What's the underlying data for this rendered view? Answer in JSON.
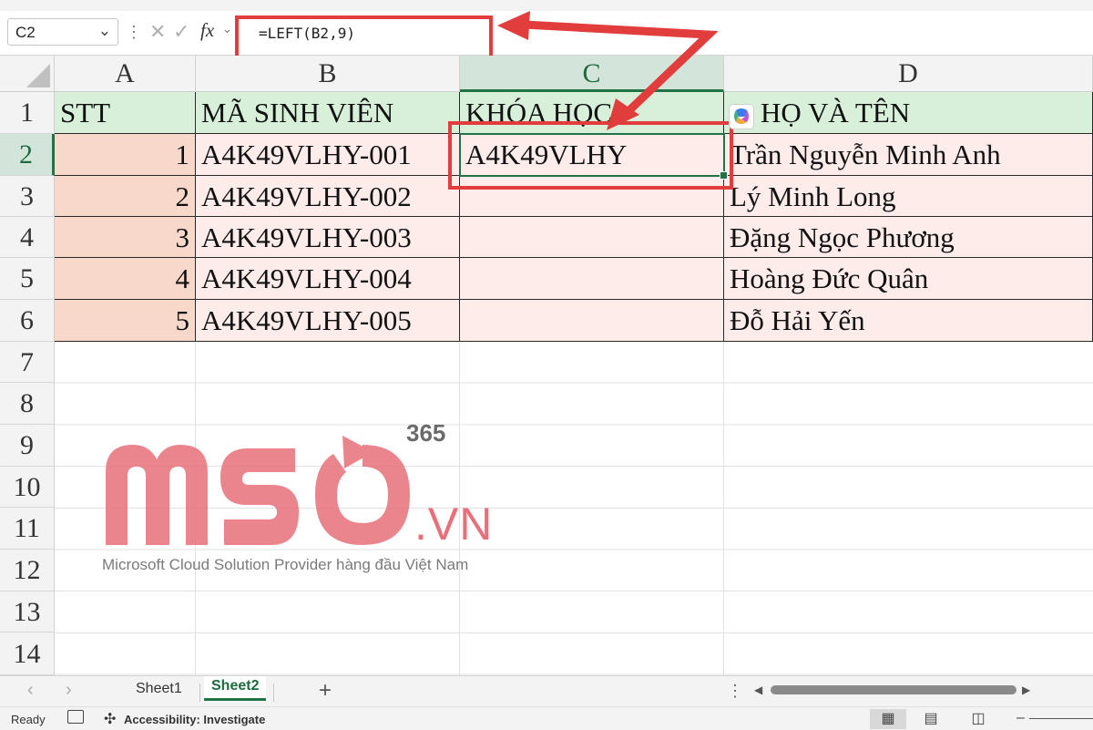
{
  "formula_bar": {
    "name_box": "C2",
    "formula": "=LEFT(B2,9)",
    "fx_label": "fx"
  },
  "columns": [
    "A",
    "B",
    "C",
    "D"
  ],
  "rows": [
    "1",
    "2",
    "3",
    "4",
    "5",
    "6",
    "7",
    "8",
    "9",
    "10",
    "11",
    "12",
    "13",
    "14"
  ],
  "table": {
    "headers": [
      "STT",
      "MÃ SINH VIÊN",
      "KHÓA HỌC",
      "HỌ VÀ TÊN"
    ],
    "rows": [
      [
        "1",
        "A4K49VLHY-001",
        "A4K49VLHY",
        "Trần Nguyễn Minh Anh"
      ],
      [
        "2",
        "A4K49VLHY-002",
        "",
        "Lý Minh Long"
      ],
      [
        "3",
        "A4K49VLHY-003",
        "",
        "Đặng Ngọc Phương"
      ],
      [
        "4",
        "A4K49VLHY-004",
        "",
        "Hoàng Đức Quân"
      ],
      [
        "5",
        "A4K49VLHY-005",
        "",
        "Đỗ Hải Yến"
      ]
    ]
  },
  "selected_cell": "C2",
  "watermark": {
    "brand": "MSO",
    "superscript": "365",
    "suffix": ".VN",
    "tagline": "Microsoft Cloud Solution Provider hàng đầu Việt Nam"
  },
  "sheet_tabs": {
    "tabs": [
      "Sheet1",
      "Sheet2"
    ],
    "active": "Sheet2",
    "add_label": "+"
  },
  "status_bar": {
    "ready": "Ready",
    "accessibility": "Accessibility: Investigate"
  },
  "colors": {
    "excel_green": "#217346",
    "annotation_red": "#e23d3d",
    "header_fill": "#d8f0d9",
    "data_fill": "#fdecea",
    "stt_fill": "#f9d8cc",
    "watermark_pink": "#e8707a"
  },
  "icons": {
    "cancel": "close-icon",
    "enter": "check-icon",
    "copilot": "copilot-icon",
    "macro": "macro-recorder-icon",
    "accessibility": "accessibility-icon"
  }
}
